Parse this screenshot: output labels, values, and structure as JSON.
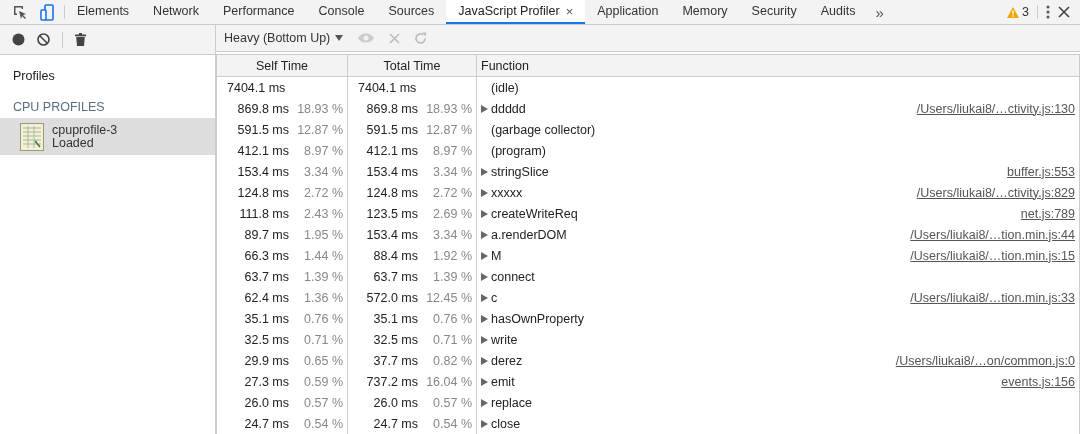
{
  "tabs": [
    {
      "label": "Elements",
      "selected": false
    },
    {
      "label": "Network",
      "selected": false
    },
    {
      "label": "Performance",
      "selected": false
    },
    {
      "label": "Console",
      "selected": false
    },
    {
      "label": "Sources",
      "selected": false
    },
    {
      "label": "JavaScript Profiler",
      "selected": true,
      "close_icon": "×"
    },
    {
      "label": "Application",
      "selected": false
    },
    {
      "label": "Memory",
      "selected": false
    },
    {
      "label": "Security",
      "selected": false
    },
    {
      "label": "Audits",
      "selected": false
    }
  ],
  "more_tabs": "»",
  "warning_count": "3",
  "view_mode": "Heavy (Bottom Up)",
  "sidebar": {
    "title": "Profiles",
    "section": "CPU PROFILES",
    "items": [
      {
        "name": "cpuprofile-3",
        "status": "Loaded",
        "selected": true
      }
    ]
  },
  "table": {
    "columns": [
      "Self Time",
      "Total Time",
      "Function"
    ],
    "rows": [
      {
        "self": "7404.1 ms",
        "total": "7404.1 ms",
        "function": "(idle)",
        "expandable": false
      },
      {
        "self": "869.8 ms",
        "self_pct": "18.93 %",
        "total": "869.8 ms",
        "total_pct": "18.93 %",
        "function": "ddddd",
        "expandable": true,
        "url": "/Users/liukai8/…ctivity.js:130"
      },
      {
        "self": "591.5 ms",
        "self_pct": "12.87 %",
        "total": "591.5 ms",
        "total_pct": "12.87 %",
        "function": "(garbage collector)",
        "expandable": false
      },
      {
        "self": "412.1 ms",
        "self_pct": "8.97 %",
        "total": "412.1 ms",
        "total_pct": "8.97 %",
        "function": "(program)",
        "expandable": false
      },
      {
        "self": "153.4 ms",
        "self_pct": "3.34 %",
        "total": "153.4 ms",
        "total_pct": "3.34 %",
        "function": "stringSlice",
        "expandable": true,
        "url": "buffer.js:553"
      },
      {
        "self": "124.8 ms",
        "self_pct": "2.72 %",
        "total": "124.8 ms",
        "total_pct": "2.72 %",
        "function": "xxxxx",
        "expandable": true,
        "url": "/Users/liukai8/…ctivity.js:829"
      },
      {
        "self": "111.8 ms",
        "self_pct": "2.43 %",
        "total": "123.5 ms",
        "total_pct": "2.69 %",
        "function": "createWriteReq",
        "expandable": true,
        "url": "net.js:789"
      },
      {
        "self": "89.7 ms",
        "self_pct": "1.95 %",
        "total": "153.4 ms",
        "total_pct": "3.34 %",
        "function": "a.renderDOM",
        "expandable": true,
        "url": "/Users/liukai8/…tion.min.js:44"
      },
      {
        "self": "66.3 ms",
        "self_pct": "1.44 %",
        "total": "88.4 ms",
        "total_pct": "1.92 %",
        "function": "M",
        "expandable": true,
        "url": "/Users/liukai8/…tion.min.js:15"
      },
      {
        "self": "63.7 ms",
        "self_pct": "1.39 %",
        "total": "63.7 ms",
        "total_pct": "1.39 %",
        "function": "connect",
        "expandable": true
      },
      {
        "self": "62.4 ms",
        "self_pct": "1.36 %",
        "total": "572.0 ms",
        "total_pct": "12.45 %",
        "function": "c",
        "expandable": true,
        "url": "/Users/liukai8/…tion.min.js:33"
      },
      {
        "self": "35.1 ms",
        "self_pct": "0.76 %",
        "total": "35.1 ms",
        "total_pct": "0.76 %",
        "function": "hasOwnProperty",
        "expandable": true
      },
      {
        "self": "32.5 ms",
        "self_pct": "0.71 %",
        "total": "32.5 ms",
        "total_pct": "0.71 %",
        "function": "write",
        "expandable": true
      },
      {
        "self": "29.9 ms",
        "self_pct": "0.65 %",
        "total": "37.7 ms",
        "total_pct": "0.82 %",
        "function": "derez",
        "expandable": true,
        "url": "/Users/liukai8/…on/common.js:0"
      },
      {
        "self": "27.3 ms",
        "self_pct": "0.59 %",
        "total": "737.2 ms",
        "total_pct": "16.04 %",
        "function": "emit",
        "expandable": true,
        "url": "events.js:156"
      },
      {
        "self": "26.0 ms",
        "self_pct": "0.57 %",
        "total": "26.0 ms",
        "total_pct": "0.57 %",
        "function": "replace",
        "expandable": true
      },
      {
        "self": "24.7 ms",
        "self_pct": "0.54 %",
        "total": "24.7 ms",
        "total_pct": "0.54 %",
        "function": "close",
        "expandable": true
      }
    ]
  }
}
